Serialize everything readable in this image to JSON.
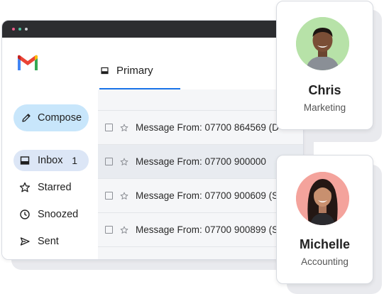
{
  "app": {
    "brand": "Gmail"
  },
  "sidebar": {
    "compose_label": "Compose",
    "items": [
      {
        "label": "Inbox",
        "count": "1",
        "icon": "inbox-icon",
        "active": true
      },
      {
        "label": "Starred",
        "count": "",
        "icon": "star-icon"
      },
      {
        "label": "Snoozed",
        "count": "",
        "icon": "clock-icon"
      },
      {
        "label": "Sent",
        "count": "",
        "icon": "send-icon"
      }
    ]
  },
  "main": {
    "tab_label": "Primary",
    "messages": [
      {
        "text": "Message From: 07700 864569 (D"
      },
      {
        "text": "Message From: 07700 900000"
      },
      {
        "text": "Message From: 07700 900609 (Sc"
      },
      {
        "text": "Message From: 07700 900899 (Sa"
      }
    ]
  },
  "contacts": [
    {
      "name": "Chris",
      "role": "Marketing",
      "avatar_bg": "#b7e2a8"
    },
    {
      "name": "Michelle",
      "role": "Accounting",
      "avatar_bg": "#f4a39c"
    }
  ],
  "colors": {
    "accent": "#1a73e8",
    "compose_bg": "#c8e6fb",
    "titlebar": "#2c2d30"
  }
}
